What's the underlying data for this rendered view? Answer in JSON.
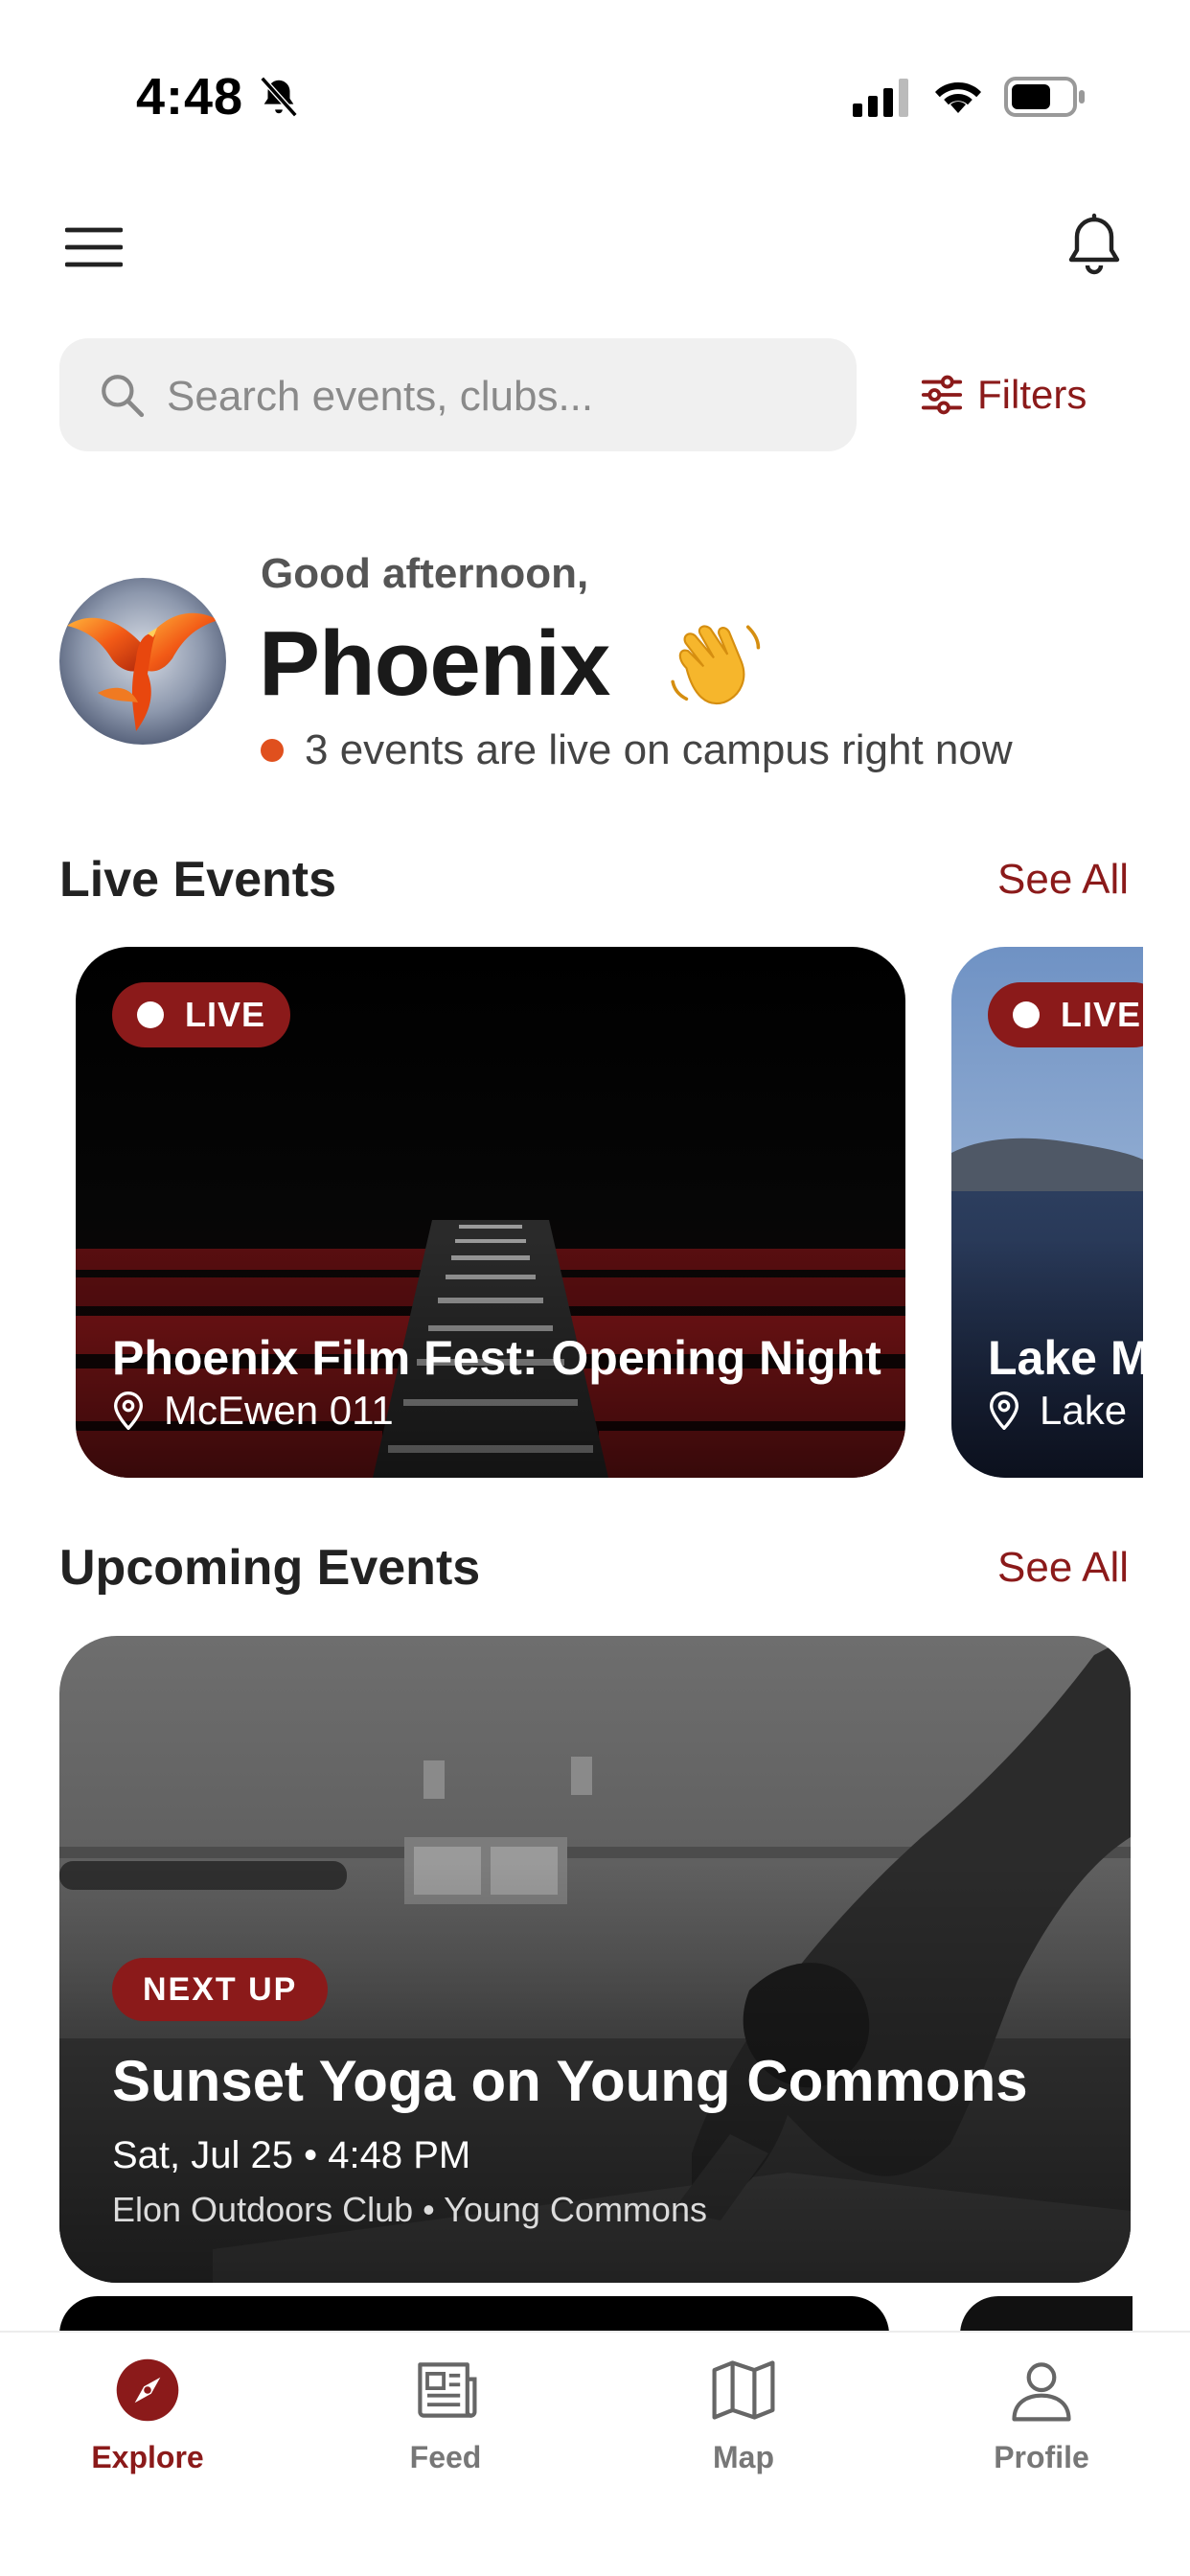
{
  "status_bar": {
    "time": "4:48"
  },
  "search": {
    "placeholder": "Search events, clubs..."
  },
  "filters_label": "Filters",
  "greeting": {
    "salutation": "Good afternoon,",
    "name": "Phoenix",
    "live_note": "3 events are live on campus right now"
  },
  "live_section": {
    "title": "Live Events",
    "see_all": "See All",
    "cards": [
      {
        "badge": "LIVE",
        "title": "Phoenix Film Fest: Opening Night",
        "location": "McEwen 011"
      },
      {
        "badge": "LIVE",
        "title": "Lake M",
        "location": "Lake"
      }
    ]
  },
  "upcoming_section": {
    "title": "Upcoming Events",
    "see_all": "See All",
    "card": {
      "badge": "NEXT UP",
      "title": "Sunset Yoga on Young Commons",
      "datetime": "Sat, Jul 25 • 4:48 PM",
      "host": "Elon Outdoors Club • Young Commons"
    }
  },
  "tabs": [
    {
      "label": "Explore",
      "icon": "compass-icon",
      "active": true
    },
    {
      "label": "Feed",
      "icon": "newspaper-icon",
      "active": false
    },
    {
      "label": "Map",
      "icon": "map-icon",
      "active": false
    },
    {
      "label": "Profile",
      "icon": "person-icon",
      "active": false
    }
  ],
  "colors": {
    "accent": "#8b1a1a",
    "live_dot": "#e0501e",
    "search_bg": "#f0f0f0"
  }
}
